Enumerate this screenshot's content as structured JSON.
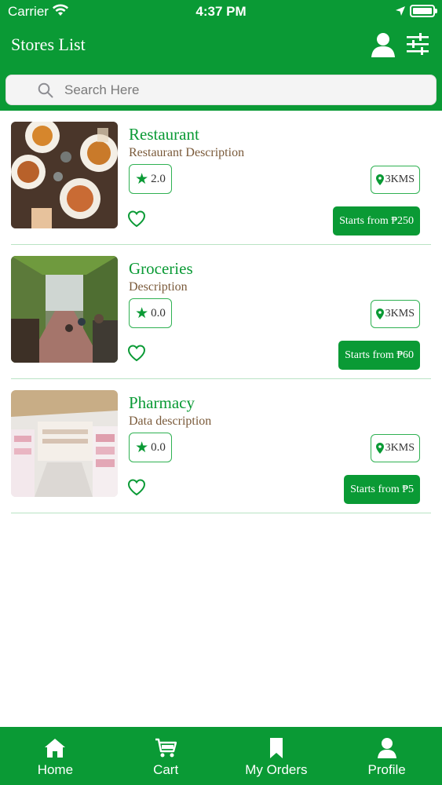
{
  "status_bar": {
    "carrier": "Carrier",
    "time": "4:37 PM"
  },
  "header": {
    "title": "Stores List",
    "icons": [
      "user-icon",
      "filter-sliders-icon"
    ]
  },
  "search": {
    "placeholder": "Search Here"
  },
  "stores": [
    {
      "name": "Restaurant",
      "description": "Restaurant Description",
      "rating": "2.0",
      "distance": "3KMS",
      "price_label": "Starts from ₱250"
    },
    {
      "name": "Groceries",
      "description": "Description",
      "rating": "0.0",
      "distance": "3KMS",
      "price_label": "Starts from ₱60"
    },
    {
      "name": "Pharmacy",
      "description": "Data description",
      "rating": "0.0",
      "distance": "3KMS",
      "price_label": "Starts from ₱5"
    }
  ],
  "tabs": [
    {
      "label": "Home",
      "icon": "home-icon"
    },
    {
      "label": "Cart",
      "icon": "cart-icon"
    },
    {
      "label": "My Orders",
      "icon": "bookmark-icon"
    },
    {
      "label": "Profile",
      "icon": "profile-icon"
    }
  ],
  "colors": {
    "brand_green": "#0a9a35",
    "border_green": "#2fb152",
    "description_brown": "#7a5a3a"
  }
}
